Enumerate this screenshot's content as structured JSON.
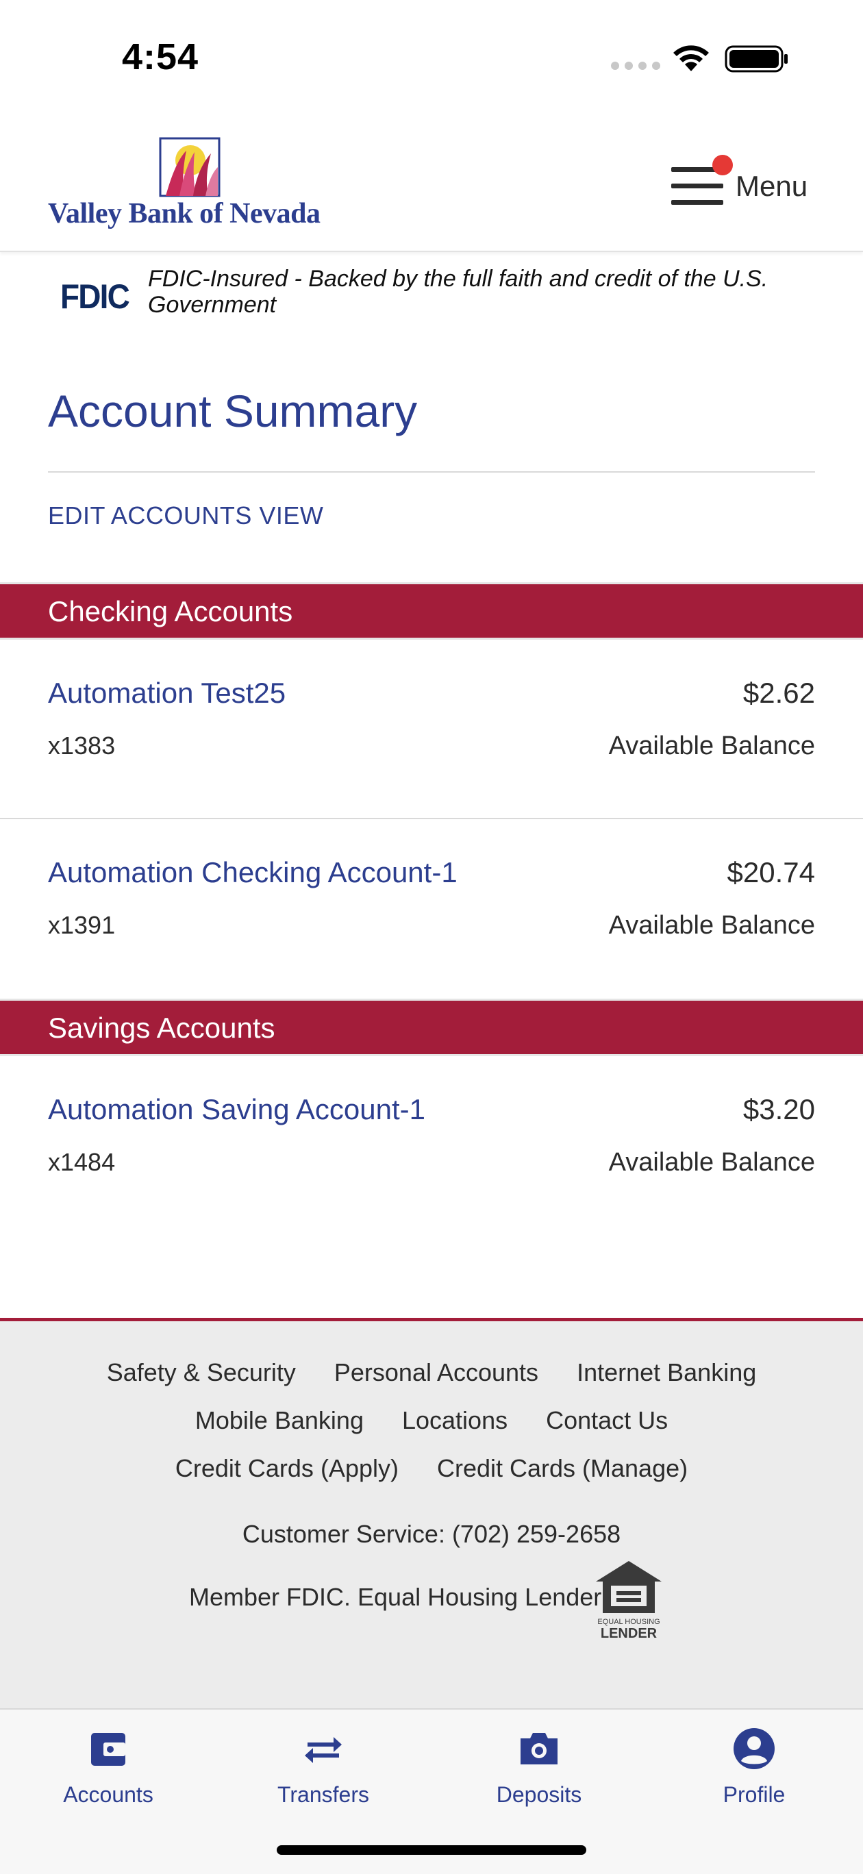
{
  "status_bar": {
    "time": "4:54"
  },
  "header": {
    "brand": "Valley Bank of Nevada",
    "menu_label": "Menu"
  },
  "fdic": {
    "logo": "FDIC",
    "text": "FDIC-Insured - Backed by the full faith and credit of the U.S. Government"
  },
  "main": {
    "title": "Account Summary",
    "edit_link": "EDIT ACCOUNTS VIEW"
  },
  "sections": [
    {
      "title": "Checking Accounts",
      "accounts": [
        {
          "name": "Automation Test25",
          "number": "x1383",
          "balance": "$2.62",
          "balance_label": "Available Balance"
        },
        {
          "name": "Automation Checking Account-1",
          "number": "x1391",
          "balance": "$20.74",
          "balance_label": "Available Balance"
        }
      ]
    },
    {
      "title": "Savings Accounts",
      "accounts": [
        {
          "name": "Automation Saving Account-1",
          "number": "x1484",
          "balance": "$3.20",
          "balance_label": "Available Balance"
        }
      ]
    }
  ],
  "footer": {
    "links": [
      [
        "Safety & Security",
        "Personal Accounts",
        "Internet Banking"
      ],
      [
        "Mobile Banking",
        "Locations",
        "Contact Us"
      ],
      [
        "Credit Cards (Apply)",
        "Credit Cards (Manage)"
      ]
    ],
    "customer_service": "Customer Service: (702) 259-2658",
    "member": "Member FDIC. Equal Housing Lender",
    "ehl_line1": "EQUAL HOUSING",
    "ehl_line2": "LENDER"
  },
  "tabs": [
    {
      "label": "Accounts",
      "icon": "wallet-icon"
    },
    {
      "label": "Transfers",
      "icon": "transfer-arrows-icon"
    },
    {
      "label": "Deposits",
      "icon": "camera-icon"
    },
    {
      "label": "Profile",
      "icon": "user-circle-icon"
    }
  ],
  "colors": {
    "brand_blue": "#2c3e8f",
    "section_red": "#a31d3a",
    "notification": "#e53935"
  }
}
